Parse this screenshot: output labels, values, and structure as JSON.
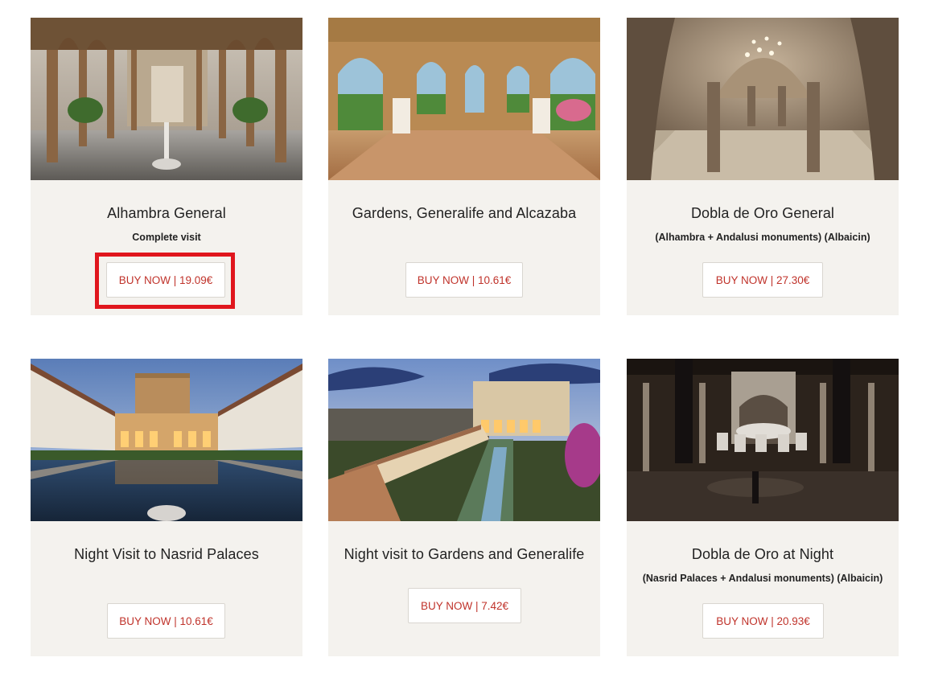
{
  "tours": [
    {
      "title": "Alhambra General",
      "subtitle": "Complete visit",
      "button_label": "BUY NOW | 19.09€",
      "image_icon": "courtyard-arcade-photo"
    },
    {
      "title": "Gardens, Generalife and Alcazaba",
      "subtitle": "",
      "button_label": "BUY NOW | 10.61€",
      "image_icon": "arched-pavilion-photo"
    },
    {
      "title": "Dobla de Oro General",
      "subtitle": "(Alhambra + Andalusi monuments) (Albaicin)",
      "button_label": "BUY NOW | 27.30€",
      "image_icon": "arab-baths-photo"
    },
    {
      "title": "Night Visit to Nasrid Palaces",
      "subtitle": "",
      "button_label": "BUY NOW | 10.61€",
      "image_icon": "reflecting-pool-photo"
    },
    {
      "title": "Night visit to Gardens and Generalife",
      "subtitle": "",
      "button_label": "BUY NOW | 7.42€",
      "image_icon": "generalife-gardens-photo"
    },
    {
      "title": "Dobla de Oro at Night",
      "subtitle": "(Nasrid Palaces + Andalusi monuments) (Albaicin)",
      "button_label": "BUY NOW | 20.93€",
      "image_icon": "lions-courtyard-photo"
    }
  ],
  "colors": {
    "card_background": "#f4f2ee",
    "button_text": "#c0332b",
    "highlight_border": "#e0161d"
  }
}
